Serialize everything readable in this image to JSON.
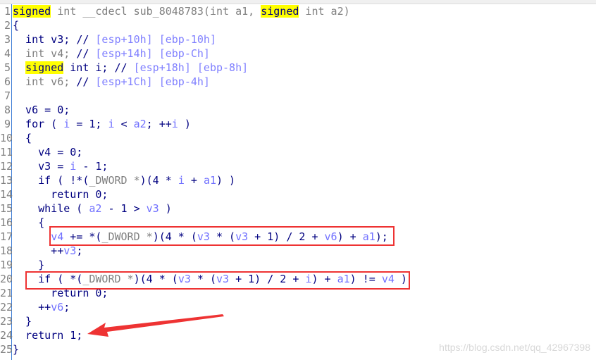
{
  "lines": [
    [
      [
        "signed",
        "hl"
      ],
      [
        " int __cdecl sub_8048783(int a1, ",
        "ty"
      ],
      [
        "signed",
        "hl"
      ],
      [
        " int a2)",
        "ty"
      ]
    ],
    [
      [
        "{",
        "pl"
      ]
    ],
    [
      [
        "  int v3; ",
        "pl"
      ],
      [
        "// ",
        "pl"
      ],
      [
        "[esp+10h] [ebp-10h]",
        "cm"
      ]
    ],
    [
      [
        "  int v4; ",
        "ty"
      ],
      [
        "// ",
        "pl"
      ],
      [
        "[esp+14h] [ebp-Ch]",
        "cm"
      ]
    ],
    [
      [
        "  ",
        "pl"
      ],
      [
        "signed",
        "hl"
      ],
      [
        " int i; // ",
        "pl"
      ],
      [
        "[esp+18h] [ebp-8h]",
        "cm"
      ]
    ],
    [
      [
        "  int v6; ",
        "ty"
      ],
      [
        "// ",
        "pl"
      ],
      [
        "[esp+1Ch] [ebp-4h]",
        "cm"
      ]
    ],
    [],
    [
      [
        "  v6 = 0;",
        "pl"
      ]
    ],
    [
      [
        "  for ( ",
        "pl"
      ],
      [
        "i",
        "var"
      ],
      [
        " = 1; ",
        "pl"
      ],
      [
        "i",
        "var"
      ],
      [
        " < ",
        "pl"
      ],
      [
        "a2",
        "var"
      ],
      [
        "; ++",
        "pl"
      ],
      [
        "i",
        "var"
      ],
      [
        " )",
        "pl"
      ]
    ],
    [
      [
        "  {",
        "pl"
      ]
    ],
    [
      [
        "    v4 = 0;",
        "pl"
      ]
    ],
    [
      [
        "    v3 = ",
        "pl"
      ],
      [
        "i",
        "var"
      ],
      [
        " - 1;",
        "pl"
      ]
    ],
    [
      [
        "    if ( !*(",
        "pl"
      ],
      [
        "_DWORD *",
        "ty"
      ],
      [
        ")(4 * ",
        "pl"
      ],
      [
        "i",
        "var"
      ],
      [
        " + ",
        "pl"
      ],
      [
        "a1",
        "var"
      ],
      [
        ") )",
        "pl"
      ]
    ],
    [
      [
        "      return 0;",
        "pl"
      ]
    ],
    [
      [
        "    while ( ",
        "pl"
      ],
      [
        "a2",
        "var"
      ],
      [
        " - 1 > ",
        "pl"
      ],
      [
        "v3",
        "var"
      ],
      [
        " )",
        "pl"
      ]
    ],
    [
      [
        "    {",
        "pl"
      ]
    ],
    [
      [
        "      ",
        "pl"
      ],
      [
        "v4",
        "var"
      ],
      [
        " += *(",
        "pl"
      ],
      [
        "_DWORD *",
        "ty"
      ],
      [
        ")(4 * (",
        "pl"
      ],
      [
        "v3",
        "var"
      ],
      [
        " * (",
        "pl"
      ],
      [
        "v3",
        "var"
      ],
      [
        " + 1) / 2 + ",
        "pl"
      ],
      [
        "v6",
        "var"
      ],
      [
        ") + ",
        "pl"
      ],
      [
        "a1",
        "var"
      ],
      [
        ");",
        "pl"
      ]
    ],
    [
      [
        "      ++",
        "pl"
      ],
      [
        "v3",
        "var"
      ],
      [
        ";",
        "pl"
      ]
    ],
    [
      [
        "    }",
        "pl"
      ]
    ],
    [
      [
        "    if ( *(",
        "pl"
      ],
      [
        "_DWORD *",
        "ty"
      ],
      [
        ")(4 * (",
        "pl"
      ],
      [
        "v3",
        "var"
      ],
      [
        " * (",
        "pl"
      ],
      [
        "v3",
        "var"
      ],
      [
        " + 1) / 2 + ",
        "pl"
      ],
      [
        "i",
        "var"
      ],
      [
        ") + ",
        "pl"
      ],
      [
        "a1",
        "var"
      ],
      [
        ") != ",
        "pl"
      ],
      [
        "v4",
        "var"
      ],
      [
        " )",
        "pl"
      ]
    ],
    [
      [
        "      return 0;",
        "pl"
      ]
    ],
    [
      [
        "    ++",
        "pl"
      ],
      [
        "v6",
        "var"
      ],
      [
        ";",
        "pl"
      ]
    ],
    [
      [
        "  }",
        "pl"
      ]
    ],
    [
      [
        "  return 1;",
        "pl"
      ]
    ],
    [
      [
        "}",
        "pl"
      ]
    ]
  ],
  "watermark": "https://blog.csdn.net/qq_42967398",
  "colors": {
    "annotation": "#ee3333",
    "highlight": "#ffff00",
    "keyword": "#000080",
    "variable": "#7070ff"
  }
}
